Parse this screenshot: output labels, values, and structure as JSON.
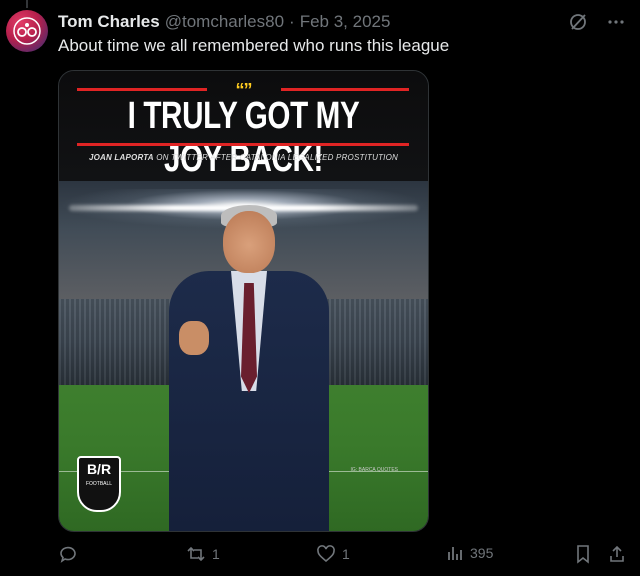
{
  "post": {
    "author_name": "Tom Charles",
    "author_handle": "@tomcharles80",
    "separator": "·",
    "date": "Feb 3, 2025",
    "text": "About time we all remembered who runs this league"
  },
  "media": {
    "quote_mark": "“”",
    "headline": "I TRULY GOT MY JOY BACK!",
    "caption_bold": "JOAN LAPORTA",
    "caption_rest": " ON TWITTER AFTER CATALONIA LEGALIZED PROSTITUTION",
    "logo_text": "B/R",
    "logo_sub": "FOOTBALL",
    "watermark": "IG: BARCA QUOTES"
  },
  "actions": {
    "reply_count": "",
    "repost_count": "1",
    "like_count": "1",
    "views_count": "395"
  },
  "icons": [
    "grok-icon",
    "more-icon",
    "reply-icon",
    "repost-icon",
    "like-icon",
    "views-icon",
    "bookmark-icon",
    "share-icon"
  ]
}
